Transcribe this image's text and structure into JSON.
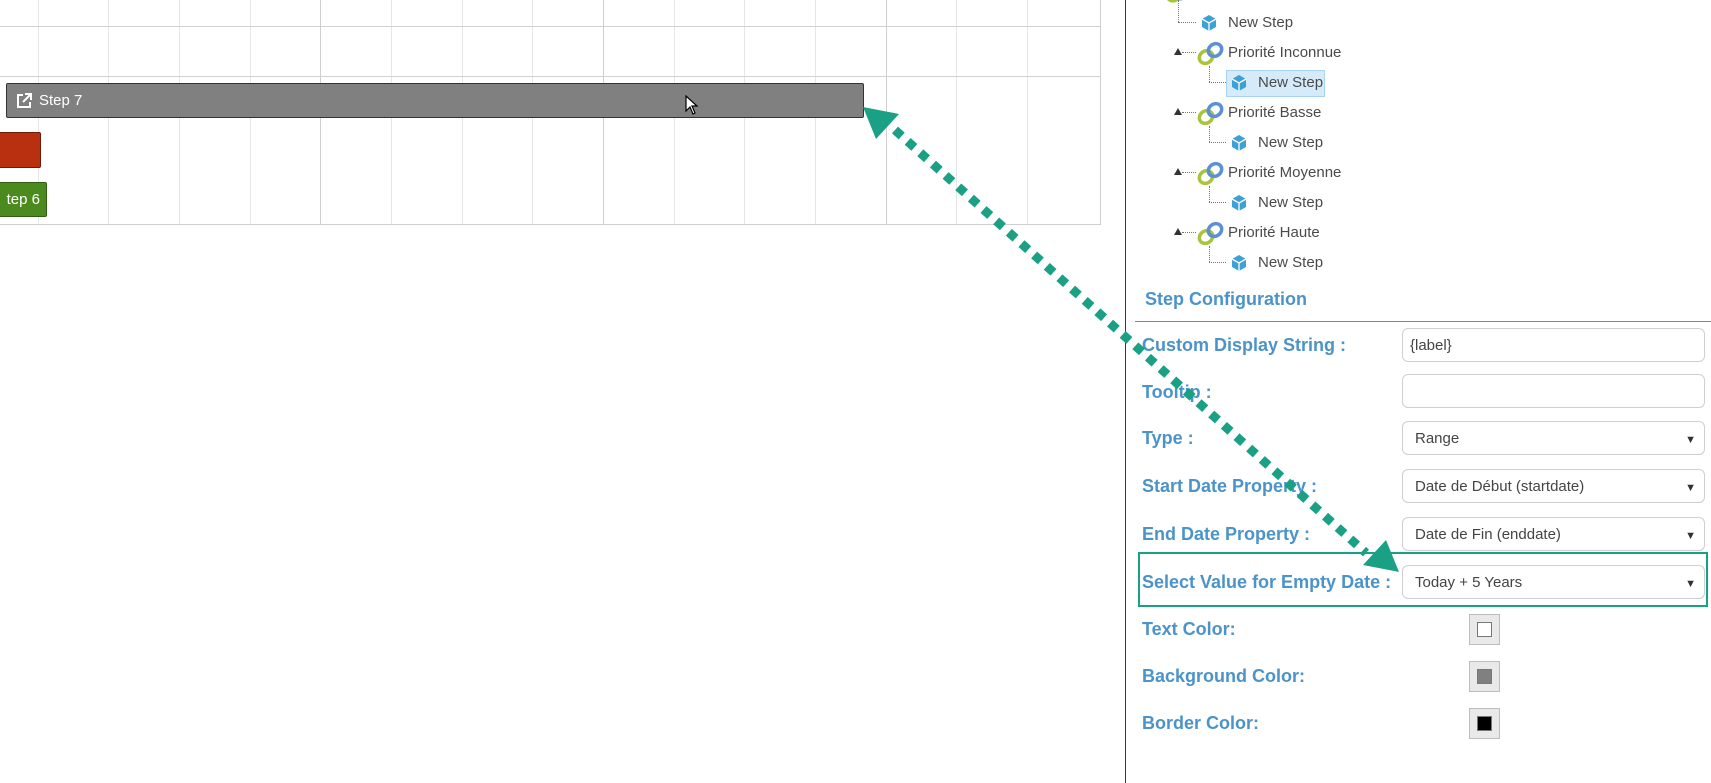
{
  "gantt": {
    "bars": [
      {
        "id": "step7",
        "label": "Step 7",
        "color": "#808080"
      },
      {
        "id": "red",
        "label": "",
        "color": "#b83010"
      },
      {
        "id": "step6",
        "label": "tep 6",
        "color": "#4b8a1e"
      }
    ],
    "open_icon": "external-link-icon"
  },
  "tree": {
    "items": [
      {
        "label": "New Step",
        "icon": "cube-icon",
        "kind": "step"
      },
      {
        "label": "Priorité Inconnue",
        "icon": "link-icon",
        "kind": "group"
      },
      {
        "label": "New Step",
        "icon": "cube-icon",
        "kind": "step",
        "selected": true
      },
      {
        "label": "Priorité Basse",
        "icon": "link-icon",
        "kind": "group"
      },
      {
        "label": "New Step",
        "icon": "cube-icon",
        "kind": "step"
      },
      {
        "label": "Priorité Moyenne",
        "icon": "link-icon",
        "kind": "group"
      },
      {
        "label": "New Step",
        "icon": "cube-icon",
        "kind": "step"
      },
      {
        "label": "Priorité Haute",
        "icon": "link-icon",
        "kind": "group"
      },
      {
        "label": "New Step",
        "icon": "cube-icon",
        "kind": "step"
      }
    ]
  },
  "config": {
    "title": "Step Configuration",
    "fields": {
      "custom_display": {
        "label": "Custom Display String :",
        "value": "{label}"
      },
      "tooltip": {
        "label": "Tooltip :",
        "value": ""
      },
      "type": {
        "label": "Type :",
        "value": "Range"
      },
      "start_date": {
        "label": "Start Date Property :",
        "value": "Date de Début (startdate)"
      },
      "end_date": {
        "label": "End Date Property :",
        "value": "Date de Fin (enddate)"
      },
      "empty_date": {
        "label": "Select Value for Empty Date :",
        "value": "Today + 5 Years"
      },
      "text_color": {
        "label": "Text Color:",
        "value": "#ffffff"
      },
      "background_color": {
        "label": "Background Color:",
        "value": "#808080"
      },
      "border_color": {
        "label": "Border Color:",
        "value": "#000000"
      }
    }
  },
  "annotation": {
    "highlight_color": "#1aa085",
    "arrow_color": "#1aa085"
  }
}
